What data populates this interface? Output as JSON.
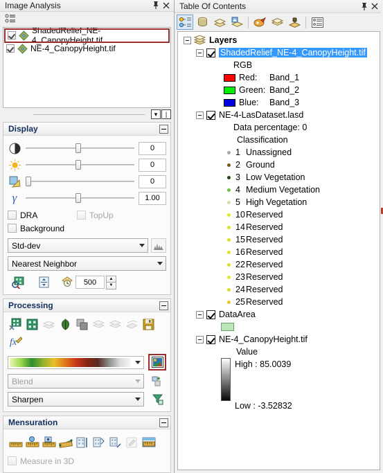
{
  "image_analysis": {
    "title": "Image Analysis",
    "pin_icon": "pin-icon",
    "close_icon": "close-icon",
    "toolbar": [
      {
        "name": "options-icon",
        "label": "Options"
      }
    ],
    "layers": [
      {
        "label": "ShadedRelief_NE-4_CanopyHeight.tif",
        "checked": true,
        "highlighted": true
      },
      {
        "label": "NE-4_CanopyHeight.tif",
        "checked": true,
        "highlighted": false
      }
    ],
    "display": {
      "title": "Display",
      "sliders": [
        {
          "icon": "contrast-icon",
          "name": "contrast",
          "value": "0",
          "thumb_pct": 46
        },
        {
          "icon": "brightness-icon",
          "name": "brightness",
          "value": "0",
          "thumb_pct": 46
        },
        {
          "icon": "transparency-icon",
          "name": "transparency",
          "value": "0",
          "thumb_pct": 0
        },
        {
          "icon": "gamma-icon",
          "name": "gamma",
          "value": "1.00",
          "thumb_pct": 46
        }
      ],
      "checkboxes": [
        {
          "label": "DRA",
          "checked": false,
          "disabled": false
        },
        {
          "label": "TopUp",
          "checked": false,
          "disabled": true
        },
        {
          "label": "Background",
          "checked": false,
          "disabled": false
        }
      ],
      "stretch_type": "Std-dev",
      "histogram_icon": "histogram-icon",
      "resample": "Nearest Neighbor",
      "buttons": [
        {
          "name": "zoom-to-raster-resolution-icon"
        },
        {
          "name": "display-properties-icon"
        },
        {
          "name": "pixel-depth-icon"
        }
      ],
      "spin_value": "500"
    },
    "processing": {
      "title": "Processing",
      "tools": [
        {
          "name": "clip-icon",
          "enabled": true
        },
        {
          "name": "mask-icon",
          "enabled": true
        },
        {
          "name": "mosaic-icon",
          "enabled": false
        },
        {
          "name": "ndvi-icon",
          "enabled": true
        },
        {
          "name": "difference-icon",
          "enabled": true
        },
        {
          "name": "composite-bands-icon",
          "enabled": false
        },
        {
          "name": "pan-sharpen-icon",
          "enabled": false
        },
        {
          "name": "orthorectify-icon",
          "enabled": false
        },
        {
          "name": "save-icon",
          "enabled": true
        },
        {
          "name": "function-editor-icon",
          "enabled": true
        }
      ],
      "color_ramp": "color-ramp",
      "ramp_picker_icon": "ramp-image-icon",
      "blend": "Blend",
      "blend_add_icon": "add-layer-icon",
      "filter": "Sharpen",
      "filter_apply_icon": "apply-filter-icon"
    },
    "mensuration": {
      "title": "Mensuration",
      "tools": [
        {
          "name": "measure-distance-icon",
          "enabled": true
        },
        {
          "name": "measure-point-icon",
          "enabled": true
        },
        {
          "name": "measure-centroid-icon",
          "enabled": true
        },
        {
          "name": "measure-area-icon",
          "enabled": true
        },
        {
          "name": "measure-height-base-top-icon",
          "enabled": true
        },
        {
          "name": "measure-height-base-shadow-icon",
          "enabled": true
        },
        {
          "name": "measure-height-top-shadow-icon",
          "enabled": true
        },
        {
          "name": "measure-settings-icon",
          "enabled": false
        },
        {
          "name": "measure-results-icon",
          "enabled": true
        }
      ],
      "measure_3d": {
        "label": "Measure in 3D",
        "checked": false
      }
    }
  },
  "toc": {
    "title": "Table Of Contents",
    "pin_icon": "pin-icon",
    "close_icon": "close-icon",
    "toolbar": [
      {
        "name": "list-by-drawing-order-icon",
        "selected": true
      },
      {
        "name": "list-by-source-icon",
        "selected": false
      },
      {
        "name": "list-by-visibility-icon",
        "selected": false
      },
      {
        "name": "list-by-selection-icon",
        "selected": false
      },
      {
        "name": "options-icon",
        "selected": false
      },
      {
        "name": "add-basemap-icon",
        "selected": false
      },
      {
        "name": "add-data-icon",
        "selected": false
      },
      {
        "name": "toc-options-icon",
        "selected": false
      }
    ],
    "root": {
      "label": "Layers",
      "icon": "layers-stack-icon"
    },
    "items": [
      {
        "type": "layer",
        "label": "ShadedRelief_NE-4_CanopyHeight.tif",
        "checked": true,
        "selected": true,
        "indent": 1
      },
      {
        "type": "text",
        "label": "RGB",
        "indent": 3
      },
      {
        "type": "band",
        "label": "Red:",
        "band": "Band_1",
        "color": "#ff0000",
        "indent": 3
      },
      {
        "type": "band",
        "label": "Green:",
        "band": "Band_2",
        "color": "#00ee00",
        "indent": 3
      },
      {
        "type": "band",
        "label": "Blue:",
        "band": "Band_3",
        "color": "#0000e0",
        "indent": 3
      },
      {
        "type": "layer",
        "label": "NE-4-LasDataset.lasd",
        "checked": true,
        "selected": false,
        "indent": 1
      },
      {
        "type": "text",
        "label": "Data percentage: 0",
        "indent": 3
      },
      {
        "type": "text",
        "label": "Classification",
        "indent": 4
      },
      {
        "type": "class",
        "num": "1",
        "label": "Unassigned",
        "color": "#a8a8a8",
        "indent": 4
      },
      {
        "type": "class",
        "num": "2",
        "label": "Ground",
        "color": "#7a5a10",
        "indent": 4
      },
      {
        "type": "class",
        "num": "3",
        "label": "Low Vegetation",
        "color": "#1e4a12",
        "indent": 4
      },
      {
        "type": "class",
        "num": "4",
        "label": "Medium Vegetation",
        "color": "#6cbf4a",
        "indent": 4
      },
      {
        "type": "class",
        "num": "5",
        "label": "High Vegetation",
        "color": "#cde3b0",
        "indent": 4
      },
      {
        "type": "class",
        "num": "10",
        "label": "Reserved",
        "color": "#e4e81c",
        "indent": 4
      },
      {
        "type": "class",
        "num": "14",
        "label": "Reserved",
        "color": "#e1e31e",
        "indent": 4
      },
      {
        "type": "class",
        "num": "15",
        "label": "Reserved",
        "color": "#e0de24",
        "indent": 4
      },
      {
        "type": "class",
        "num": "16",
        "label": "Reserved",
        "color": "#e3e220",
        "indent": 4
      },
      {
        "type": "class",
        "num": "22",
        "label": "Reserved",
        "color": "#dedf1f",
        "indent": 4
      },
      {
        "type": "class",
        "num": "23",
        "label": "Reserved",
        "color": "#e6e722",
        "indent": 4
      },
      {
        "type": "class",
        "num": "24",
        "label": "Reserved",
        "color": "#dddb2a",
        "indent": 4
      },
      {
        "type": "class",
        "num": "25",
        "label": "Reserved",
        "color": "#e8c92a",
        "indent": 4
      },
      {
        "type": "layer",
        "label": "DataArea",
        "checked": true,
        "selected": false,
        "indent": 1
      },
      {
        "type": "swatch",
        "color": "#b8e6b8",
        "indent": 3
      },
      {
        "type": "layer",
        "label": "NE-4_CanopyHeight.tif",
        "checked": true,
        "selected": false,
        "indent": 1
      },
      {
        "type": "text",
        "label": "Value",
        "indent": 4
      },
      {
        "type": "ramp",
        "high": "High : 85.0039",
        "low": "Low : -3.52832",
        "indent": 3
      }
    ]
  }
}
